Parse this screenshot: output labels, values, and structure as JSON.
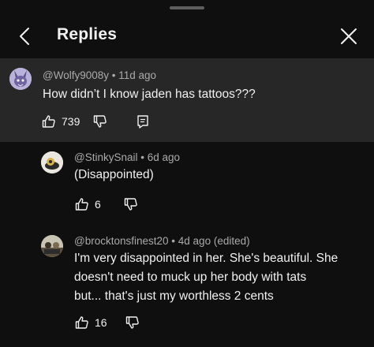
{
  "header": {
    "title": "Replies"
  },
  "parent_comment": {
    "author": "@Wolfy9008y",
    "age": "11d ago",
    "text": "How didn’t I know jaden has tattoos???",
    "likes": "739"
  },
  "replies": [
    {
      "author": "@StinkySnail",
      "age": "6d ago",
      "text": "(Disappointed)",
      "likes": "6"
    },
    {
      "author": "@brocktonsfinest20",
      "age": "4d ago (edited)",
      "text_lines": [
        "I'm very disappointed in her. She's beautiful. She",
        "doesn't need to muck up her body with tats",
        "but... that's just my worthless 2 cents"
      ],
      "likes": "16"
    }
  ],
  "colors": {
    "background": "#0f0f0f",
    "highlight": "#272727",
    "primary_text": "#f1f1f1",
    "secondary_text": "#aaaaaa"
  }
}
